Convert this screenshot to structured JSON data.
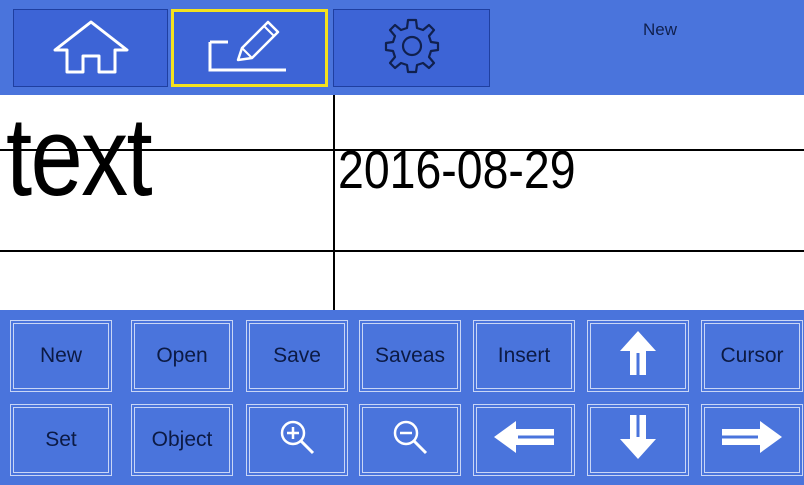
{
  "toolbar": {
    "tabs": [
      {
        "name": "home",
        "icon": "home-icon",
        "selected": false
      },
      {
        "name": "edit",
        "icon": "pencil-icon",
        "selected": true
      },
      {
        "name": "settings",
        "icon": "gear-icon",
        "selected": false
      }
    ],
    "document_name": "New"
  },
  "canvas": {
    "text_object": "text",
    "date_object": "2016-08-29"
  },
  "keypad": {
    "row1": [
      {
        "label": "New"
      },
      {
        "label": "Open"
      },
      {
        "label": "Save"
      },
      {
        "label": "Saveas"
      },
      {
        "label": "Insert"
      },
      {
        "icon": "arrow-up-icon"
      },
      {
        "label": "Cursor"
      }
    ],
    "row2": [
      {
        "label": "Set"
      },
      {
        "label": "Object"
      },
      {
        "icon": "zoom-in-icon"
      },
      {
        "icon": "zoom-out-icon"
      },
      {
        "icon": "arrow-left-icon"
      },
      {
        "icon": "arrow-down-icon"
      },
      {
        "icon": "arrow-right-icon"
      }
    ]
  },
  "colors": {
    "toolbar_background": "#4a74dc",
    "tab_selected_border": "#f4e21d",
    "key_text": "#0c1a44"
  }
}
